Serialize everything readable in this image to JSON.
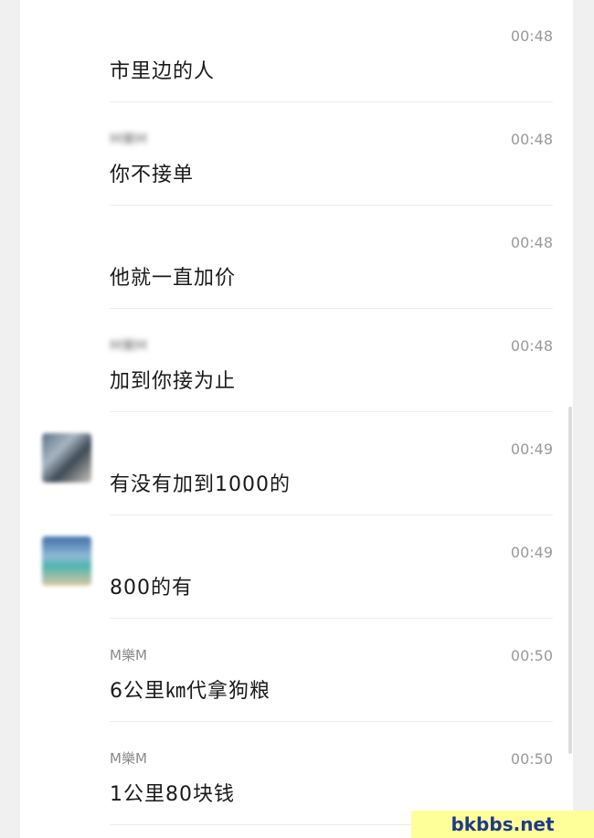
{
  "messages": [
    {
      "sender": "",
      "time": "00:48",
      "text": "市里边的人",
      "has_avatar": false
    },
    {
      "sender": "M樂M",
      "time": "00:48",
      "text": "你不接单",
      "has_avatar": false
    },
    {
      "sender": "",
      "time": "00:48",
      "text": "他就一直加价",
      "has_avatar": false
    },
    {
      "sender": "M樂M",
      "time": "00:48",
      "text": "加到你接为止",
      "has_avatar": false
    },
    {
      "sender": "",
      "time": "00:49",
      "text": "有没有加到1000的",
      "has_avatar": true
    },
    {
      "sender": "",
      "time": "00:49",
      "text": "800的有",
      "has_avatar": true
    },
    {
      "sender": "M樂M",
      "time": "00:50",
      "text": "6公里㎞代拿狗粮",
      "has_avatar": false
    },
    {
      "sender": "M樂M",
      "time": "00:50",
      "text": "1公里80块钱",
      "has_avatar": false
    }
  ],
  "watermark": "bkbbs.net"
}
